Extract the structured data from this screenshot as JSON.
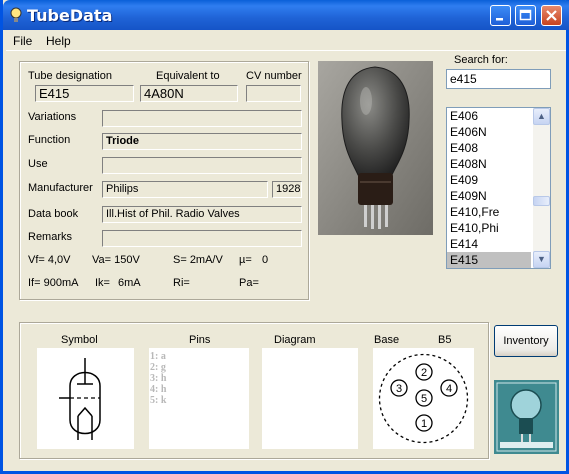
{
  "window": {
    "title": "TubeData"
  },
  "menu": {
    "file": "File",
    "help": "Help"
  },
  "header": {
    "tube_designation_label": "Tube designation",
    "equivalent_label": "Equivalent to",
    "cv_label": "CV number",
    "tube_designation": "E415",
    "equivalent": "4A80N",
    "cv_number": ""
  },
  "details": {
    "variations_label": "Variations",
    "variations": "",
    "function_label": "Function",
    "function": "Triode",
    "use_label": "Use",
    "use": "",
    "manufacturer_label": "Manufacturer",
    "manufacturer": "Philips",
    "year": "1928",
    "databook_label": "Data book",
    "databook": "Ill.Hist of Phil. Radio Valves",
    "remarks_label": "Remarks",
    "remarks": ""
  },
  "params": {
    "vf": "Vf= 4,0V",
    "va": "Va= 150V",
    "s": "S= 2mA/V",
    "mu": "µ=",
    "mu_val": "0",
    "if": "If= 900mA",
    "ik": "Ik=",
    "ik_val": "6mA",
    "ri": "Ri=",
    "pa": "Pa="
  },
  "search": {
    "label": "Search for:",
    "value": "e415"
  },
  "list": {
    "items": [
      "E406",
      "E406N",
      "E408",
      "E408N",
      "E409",
      "E409N",
      "E410,Fre",
      "E410,Phi",
      "E414",
      "E415"
    ],
    "selected_index": 9
  },
  "bottom": {
    "symbol_label": "Symbol",
    "pins_label": "Pins",
    "diagram_label": "Diagram",
    "base_label": "Base",
    "base_type": "B5",
    "pins": [
      "1: a",
      "2: g",
      "3: h",
      "4: h",
      "5: k"
    ],
    "base_pin_numbers": [
      "1",
      "2",
      "3",
      "4",
      "5"
    ]
  },
  "buttons": {
    "inventory": "Inventory"
  },
  "icons": [
    "lightbulb-icon",
    "minimize-icon",
    "maximize-icon",
    "close-icon",
    "scroll-up-icon",
    "scroll-down-icon",
    "triode-symbol-icon",
    "tube-photo",
    "logo-image"
  ],
  "colors": {
    "titlebar": "#0054e3",
    "close_button": "#c7431f",
    "selected_row": "#c0c0c0"
  }
}
